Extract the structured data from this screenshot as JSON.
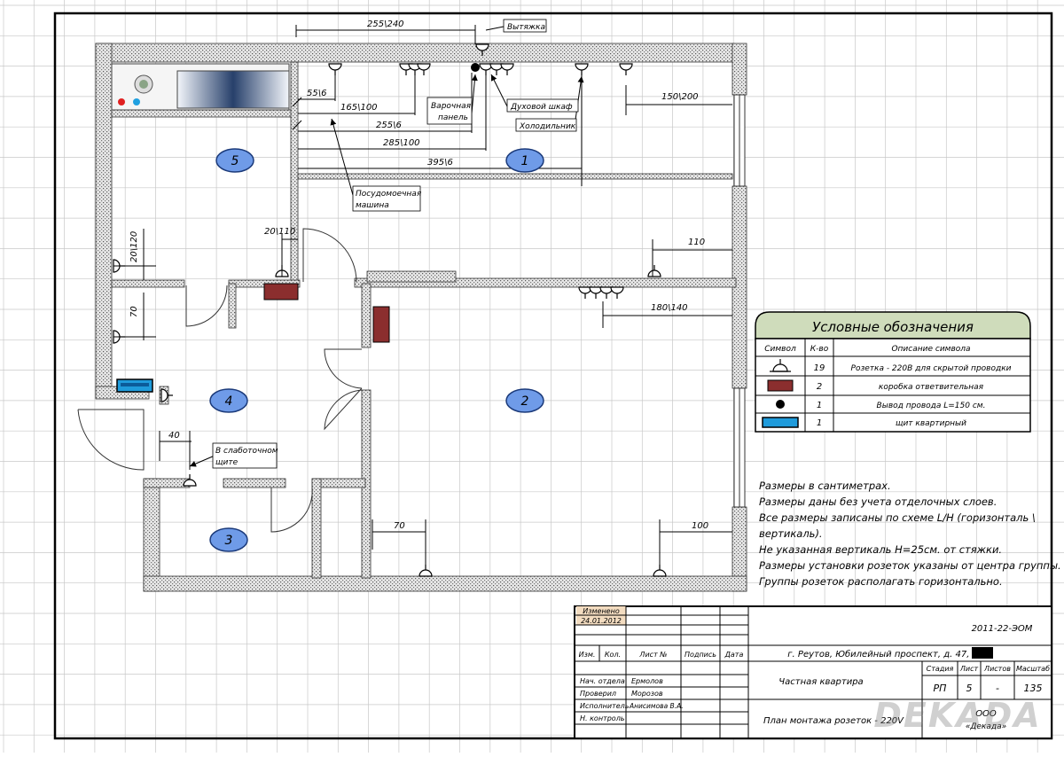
{
  "colors": {
    "grid": "#c8c8c8",
    "wall": "#9a9a9a",
    "room_badge": "#6f9be8",
    "junction_box": "#8b2e2e",
    "panel": "#1f9bdb",
    "legend_header": "#cfdcbb",
    "stamp": "#f3dcc0"
  },
  "rooms": [
    {
      "label": "1"
    },
    {
      "label": "2"
    },
    {
      "label": "3"
    },
    {
      "label": "4"
    },
    {
      "label": "5"
    }
  ],
  "callouts": {
    "hood": "Вытяжка",
    "hob_1": "Варочная",
    "hob_2": "панель",
    "oven": "Духовой шкаф",
    "fridge": "Холодильник",
    "dishwasher_1": "Посудомоечная",
    "dishwasher_2": "машина",
    "lowcurrent_1": "В слаботочном",
    "lowcurrent_2": "щите"
  },
  "dimensions": {
    "d_255_240": "255\\240",
    "d_55_6": "55\\6",
    "d_165_100": "165\\100",
    "d_255_6": "255\\6",
    "d_285_100": "285\\100",
    "d_395_6": "395\\6",
    "d_150_200": "150\\200",
    "d_20_110": "20\\110",
    "d_110": "110",
    "d_20_120": "20\\120",
    "d_70_left": "70",
    "d_180_140": "180\\140",
    "d_40": "40",
    "d_70_bottom": "70",
    "d_100": "100"
  },
  "legend": {
    "title": "Условные обозначения",
    "headers": [
      "Символ",
      "К-во",
      "Описание символа"
    ],
    "rows": [
      {
        "symbol": "socket-icon",
        "count": "19",
        "desc": "Розетка - 220В для скрытой проводки"
      },
      {
        "symbol": "junction-box-icon",
        "count": "2",
        "desc": "коробка ответвительная"
      },
      {
        "symbol": "wire-outlet-icon",
        "count": "1",
        "desc": "Вывод провода L=150 см."
      },
      {
        "symbol": "panel-icon",
        "count": "1",
        "desc": "щит квартирный"
      }
    ]
  },
  "notes": [
    "Размеры в сантиметрах.",
    "Размеры даны без учета отделочных слоев.",
    "Все размеры записаны по схеме L/H (горизонталь \\",
    "вертикаль).",
    "Не указанная вертикаль H=25см. от стяжки.",
    "Размеры установки розеток указаны от центра группы.",
    "Группы розеток располагать горизонтально."
  ],
  "title_block": {
    "changed_label": "Изменено",
    "changed_date": "24.01.2012",
    "doc_number": "2011-22-ЭОМ",
    "address": "г. Реутов, Юбилейный проспект, д. 47, кв.",
    "col_headers": [
      "Изм.",
      "Кол.",
      "Лист №",
      "Подпись",
      "Дата"
    ],
    "roles": [
      {
        "role": "Нач. отдела",
        "name": "Ермолов"
      },
      {
        "role": "Проверил",
        "name": "Морозов"
      },
      {
        "role": "Исполнитель",
        "name": "Анисимова В.А."
      },
      {
        "role": "Н. контроль",
        "name": ""
      }
    ],
    "object_name": "Частная квартира",
    "drawing_name": "План монтажа розеток - 220V",
    "stage_headers": [
      "Стадия",
      "Лист",
      "Листов",
      "Масштаб"
    ],
    "stage_values": [
      "РП",
      "5",
      "-",
      "135"
    ],
    "org_1": "ООО",
    "org_2": "«Декада»",
    "watermark": "DEKADA"
  }
}
